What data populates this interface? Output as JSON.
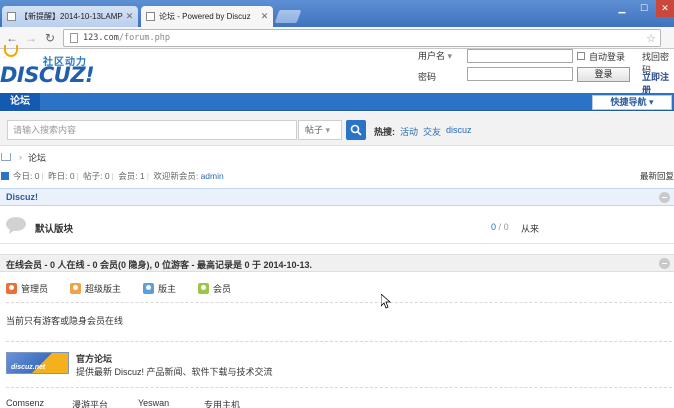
{
  "browser": {
    "tabs": [
      {
        "title": "【新提醒】2014-10-13LAMP",
        "active": false
      },
      {
        "title": "论坛 - Powered by Discuz",
        "active": true
      }
    ],
    "url_host": "123.com",
    "url_path": "/forum.php",
    "icons": [
      "back-arrow-icon",
      "forward-arrow-icon",
      "reload-icon",
      "star-icon"
    ]
  },
  "header": {
    "logo_slogan": "社区动力",
    "logo_word": "DISCUZ!",
    "username_label": "用户名",
    "password_label": "密码",
    "auto_login_label": "自动登录",
    "login_button": "登录",
    "find_password": "找回密码",
    "register": "立即注册"
  },
  "nav": {
    "forum_tab": "论坛",
    "quick_nav": "快捷导航"
  },
  "search": {
    "placeholder": "请输入搜索内容",
    "type_label": "帖子",
    "hot_label": "热搜:",
    "hot_links": [
      "活动",
      "交友",
      "discuz"
    ]
  },
  "breadcrumb": {
    "current": "论坛"
  },
  "stats": {
    "today_label": "今日:",
    "today": "0",
    "yesterday_label": "昨日:",
    "yesterday": "0",
    "posts_label": "帖子:",
    "posts": "0",
    "members_label": "会员:",
    "members": "1",
    "welcome_label": "欢迎新会员:",
    "newest_member": "admin",
    "latest_reply": "最新回复"
  },
  "category": {
    "title": "Discuz!",
    "forum_name": "默认版块",
    "threads": "0",
    "posts_sep": "/",
    "posts": "0",
    "last_post": "从来"
  },
  "online": {
    "title": "在线会员 - 0 人在线 - 0 会员(0 隐身), 0 位游客 - 最高记录是 0 于 2014-10-13.",
    "legend": [
      {
        "label": "管理员",
        "color": "#e8713a"
      },
      {
        "label": "超级版主",
        "color": "#f0a24a"
      },
      {
        "label": "版主",
        "color": "#5aa0dc"
      },
      {
        "label": "会员",
        "color": "#9cc64a"
      }
    ],
    "note": "当前只有游客或隐身会员在线"
  },
  "partner": {
    "badge_text": "discuz.net",
    "name": "官方论坛",
    "description": "提供最新 Discuz! 产品新闻、软件下载与技术交流"
  },
  "footer_links": [
    "Comsenz",
    "漫游平台",
    "Yeswan",
    "专用主机"
  ]
}
